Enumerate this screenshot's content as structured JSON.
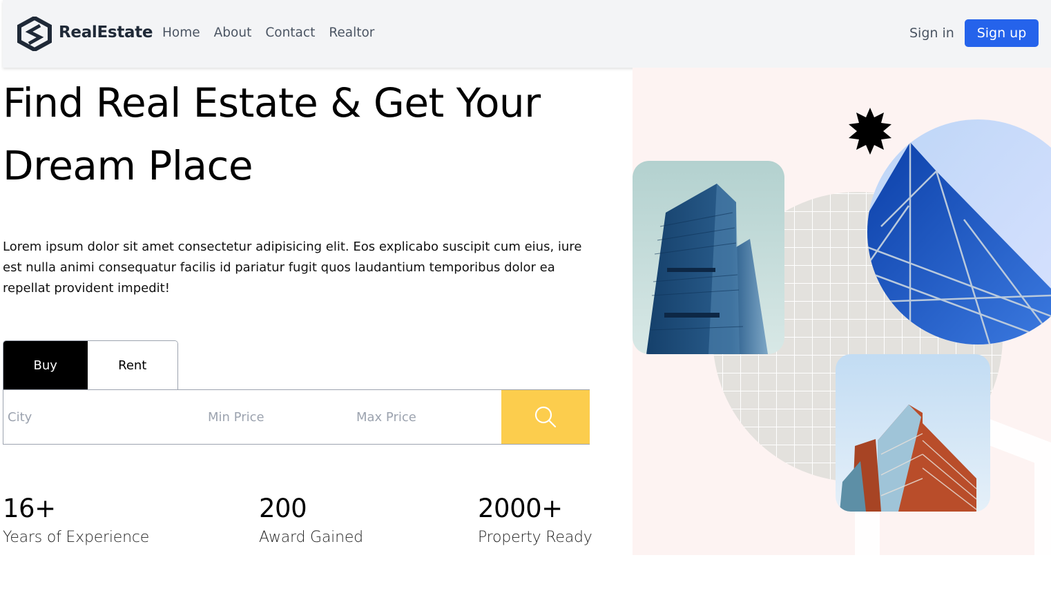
{
  "brand": {
    "name": "RealEstate",
    "logo_icon": "hexagon-s-logo-icon"
  },
  "nav": {
    "links": [
      "Home",
      "About",
      "Contact",
      "Realtor"
    ],
    "sign_in": "Sign in",
    "sign_up": "Sign up"
  },
  "hero": {
    "title_line1": "Find Real Estate & Get Your",
    "title_line2": "Dream Place",
    "description": "Lorem ipsum dolor sit amet consectetur adipisicing elit. Eos explicabo suscipit cum eius, iure est nulla animi consequatur facilis id pariatur fugit quos laudantium temporibus dolor ea repellat provident impedit!"
  },
  "search": {
    "tabs": [
      "Buy",
      "Rent"
    ],
    "active_tab": "Buy",
    "city_placeholder": "City",
    "min_price_placeholder": "Min Price",
    "max_price_placeholder": "Max Price",
    "button_icon": "search-icon"
  },
  "stats": [
    {
      "value": "16+",
      "label": "Years of Experience"
    },
    {
      "value": "200",
      "label": "Award Gained"
    },
    {
      "value": "2000+",
      "label": "Property Ready"
    }
  ],
  "colors": {
    "primary": "#2563eb",
    "search_button": "#fccd4d",
    "hero_bg": "#fdf3f2",
    "navbar_bg": "#f3f4f6"
  }
}
